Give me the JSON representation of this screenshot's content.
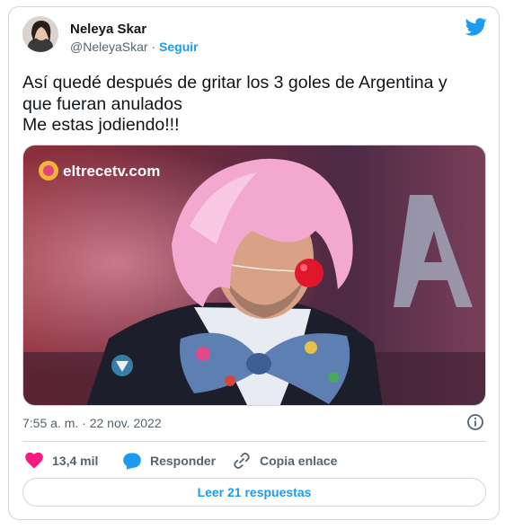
{
  "author": {
    "name": "Neleya Skar",
    "handle": "@NeleyaSkar",
    "separator": "·",
    "follow_label": "Seguir"
  },
  "tweet": {
    "lines": [
      "Así quedé después de gritar los 3 goles de Argentina y",
      "que fueran anulados",
      "Me estas jodiendo!!!"
    ],
    "timestamp": "7:55 a. m. · 22 nov. 2022"
  },
  "media": {
    "watermark": "eltrecetv.com"
  },
  "actions": {
    "likes_count": "13,4 mil",
    "reply_label": "Responder",
    "copy_link_label": "Copia enlace",
    "read_replies_label": "Leer 21 respuestas"
  },
  "colors": {
    "accent": "#1d9bf0",
    "like": "#f91880",
    "text": "#0f1419",
    "secondary": "#536471",
    "border": "#cfd9de"
  },
  "icons": [
    "twitter-bird-icon",
    "info-icon",
    "heart-icon",
    "reply-bubble-icon",
    "link-icon"
  ]
}
